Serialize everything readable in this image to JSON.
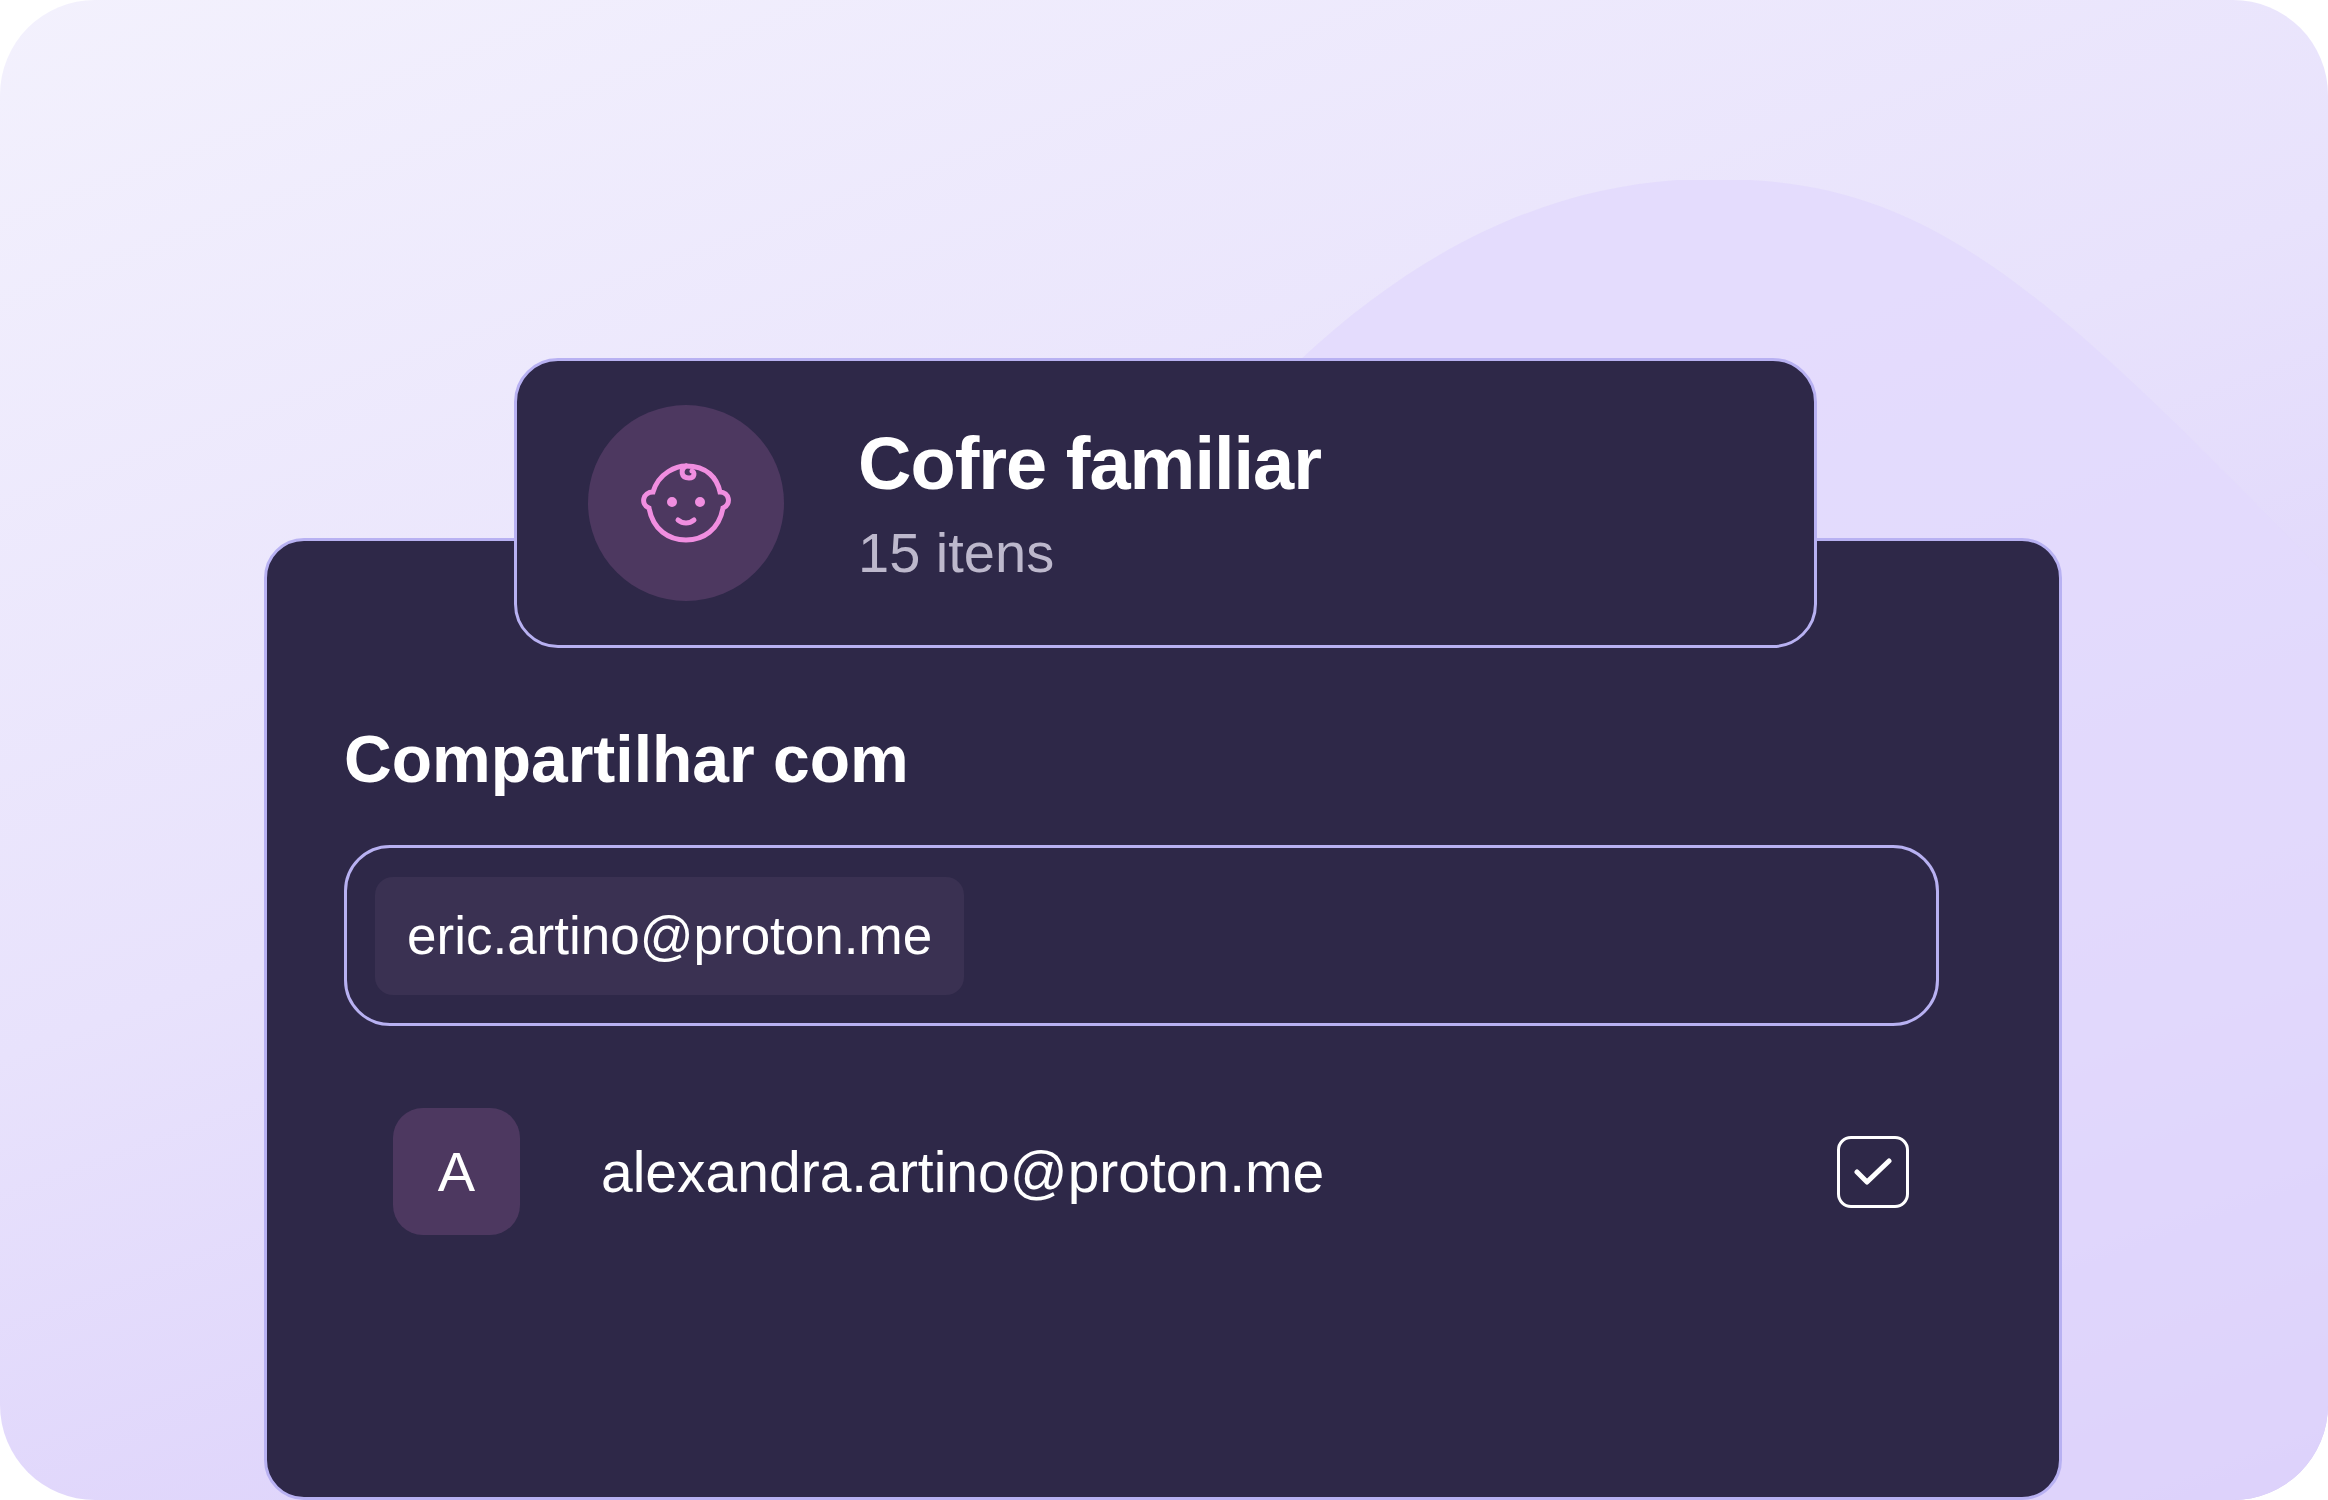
{
  "vault": {
    "name": "Cofre familiar",
    "count": "15 itens"
  },
  "share": {
    "heading": "Compartilhar com",
    "recipient_chip": "eric.artino@proton.me",
    "members": [
      {
        "initial": "A",
        "email": "alexandra.artino@proton.me",
        "checked": true
      }
    ]
  }
}
